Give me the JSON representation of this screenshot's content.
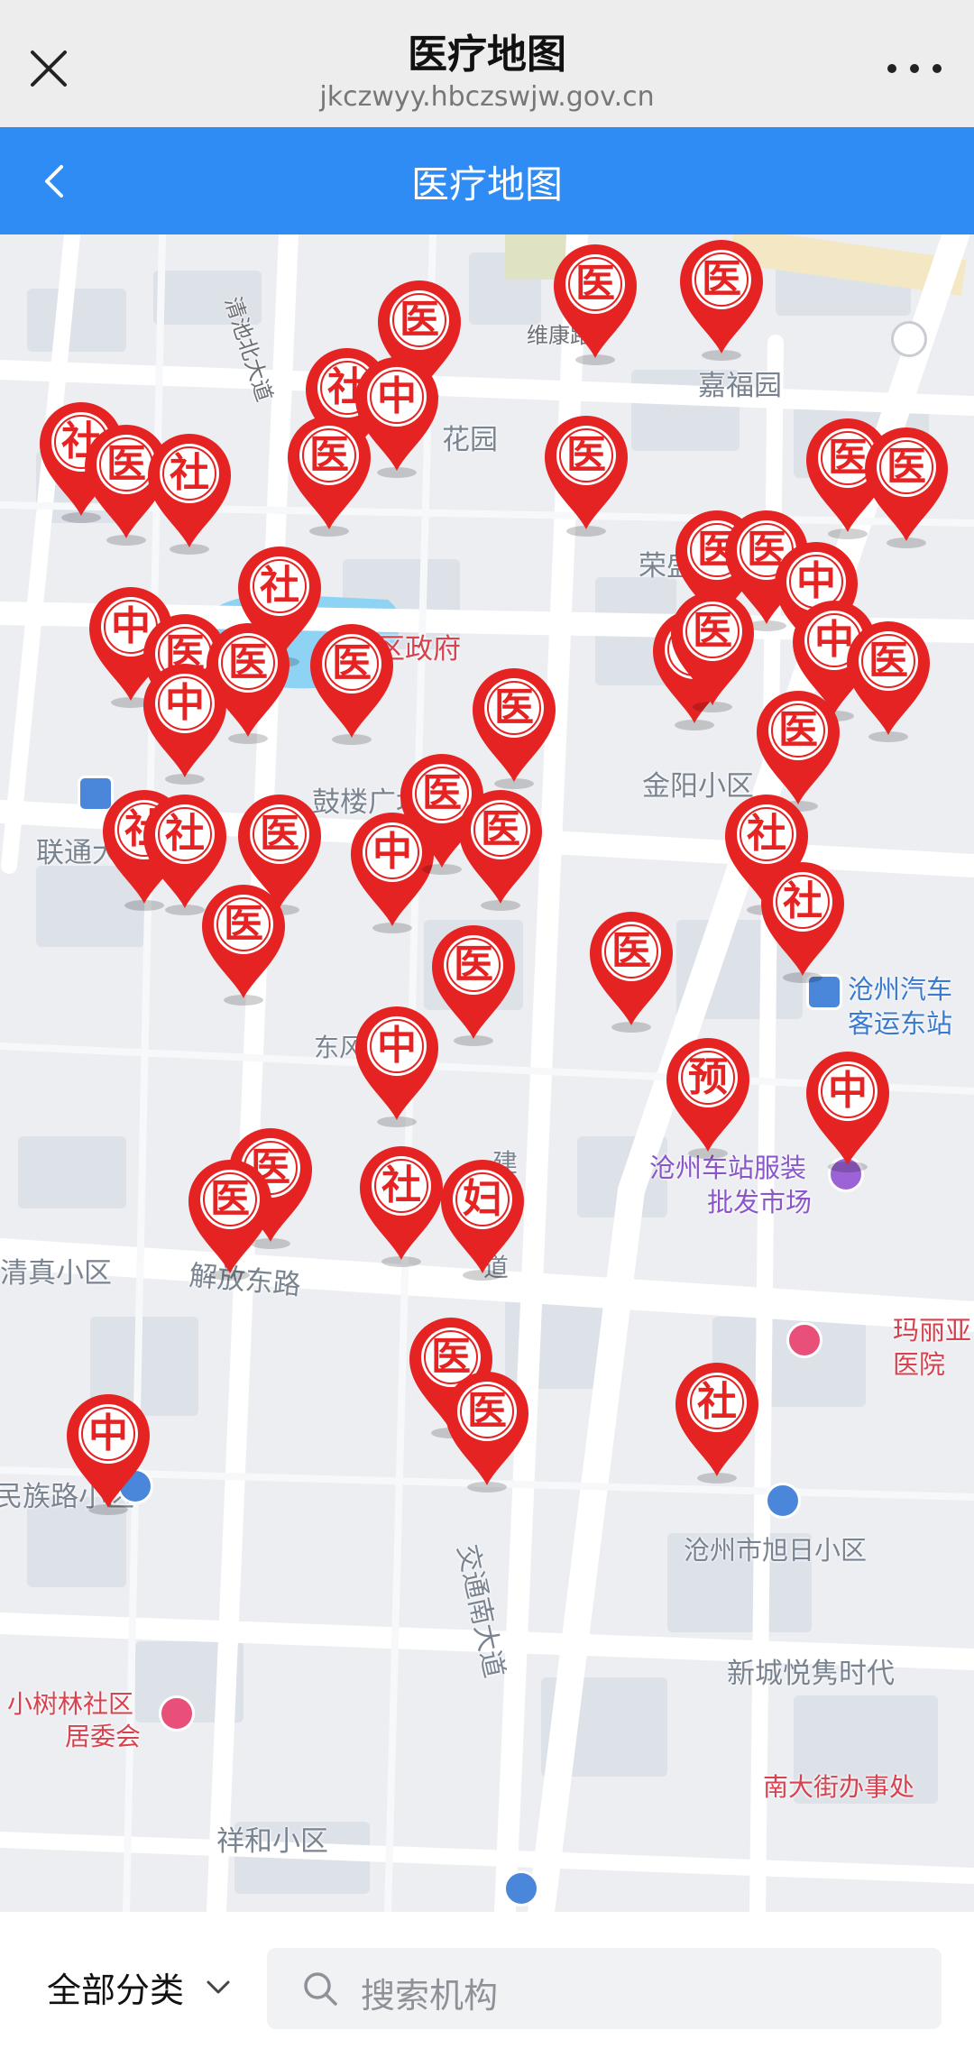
{
  "window": {
    "title": "医疗地图",
    "url": "jkczwyy.hbczswjw.gov.cn"
  },
  "header": {
    "title": "医疗地图"
  },
  "map": {
    "labels": [
      {
        "text": "嘉福园",
        "style": ""
      },
      {
        "text": "花园",
        "style": ""
      },
      {
        "text": "新华区政府",
        "style": "red"
      },
      {
        "text": "荣盛丽水花苑",
        "style": ""
      },
      {
        "text": "金阳小区",
        "style": ""
      },
      {
        "text": "鼓楼广场",
        "style": ""
      },
      {
        "text": "联通大厦",
        "style": ""
      },
      {
        "text": "沧州汽车",
        "style": "blue"
      },
      {
        "text": "客运东站",
        "style": "blue"
      },
      {
        "text": "东风路",
        "style": ""
      },
      {
        "text": "沧州车站服装",
        "style": "purple"
      },
      {
        "text": "批发市场",
        "style": "purple"
      },
      {
        "text": "清真小区",
        "style": ""
      },
      {
        "text": "解放东路",
        "style": ""
      },
      {
        "text": "玛丽亚",
        "style": "red"
      },
      {
        "text": "医院",
        "style": "red"
      },
      {
        "text": "民族路小区",
        "style": ""
      },
      {
        "text": "交通南大道",
        "style": ""
      },
      {
        "text": "沧州市旭日小区",
        "style": ""
      },
      {
        "text": "新城悦隽时代",
        "style": ""
      },
      {
        "text": "小树林社区",
        "style": "red"
      },
      {
        "text": "居委会",
        "style": "red"
      },
      {
        "text": "南大街办事处",
        "style": "red"
      },
      {
        "text": "祥和小区",
        "style": ""
      },
      {
        "text": "清池北大道",
        "style": "small"
      },
      {
        "text": "维康路",
        "style": "small"
      },
      {
        "text": "建",
        "style": ""
      },
      {
        "text": "道",
        "style": ""
      }
    ],
    "markers": [
      {
        "label": "医"
      },
      {
        "label": "医"
      },
      {
        "label": "医"
      },
      {
        "label": "社"
      },
      {
        "label": "中"
      },
      {
        "label": "社"
      },
      {
        "label": "医"
      },
      {
        "label": "社"
      },
      {
        "label": "医"
      },
      {
        "label": "医"
      },
      {
        "label": "医"
      },
      {
        "label": "医"
      },
      {
        "label": "医"
      },
      {
        "label": "医"
      },
      {
        "label": "中"
      },
      {
        "label": "社"
      },
      {
        "label": "中"
      },
      {
        "label": "医"
      },
      {
        "label": "医"
      },
      {
        "label": "医"
      },
      {
        "label": "中"
      },
      {
        "label": "医"
      },
      {
        "label": "中"
      },
      {
        "label": "医"
      },
      {
        "label": "中"
      },
      {
        "label": "医"
      },
      {
        "label": "医"
      },
      {
        "label": "社"
      },
      {
        "label": "社"
      },
      {
        "label": "医"
      },
      {
        "label": "中"
      },
      {
        "label": "医"
      },
      {
        "label": "医"
      },
      {
        "label": "社"
      },
      {
        "label": "社"
      },
      {
        "label": "医"
      },
      {
        "label": "医"
      },
      {
        "label": "医"
      },
      {
        "label": "中"
      },
      {
        "label": "预"
      },
      {
        "label": "中"
      },
      {
        "label": "医"
      },
      {
        "label": "医"
      },
      {
        "label": "社"
      },
      {
        "label": "妇"
      },
      {
        "label": "医"
      },
      {
        "label": "医"
      },
      {
        "label": "社"
      },
      {
        "label": "中"
      }
    ]
  },
  "bottom": {
    "category": "全部分类",
    "search_placeholder": "搜索机构"
  },
  "colors": {
    "header_blue": "#2f8cf5",
    "marker_red": "#e52323",
    "map_water": "#8fd3f4"
  }
}
